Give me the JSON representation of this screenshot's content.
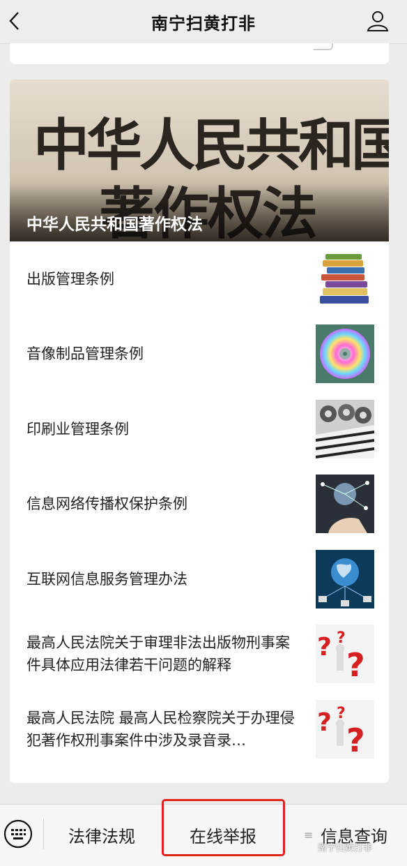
{
  "header": {
    "title": "南宁扫黄打非"
  },
  "hero": {
    "image_text_line1": "中华人民共和国",
    "image_text_line2": "著作权法",
    "caption": "中华人民共和国著作权法"
  },
  "articles": [
    {
      "title": "出版管理条例",
      "thumb": "books-icon"
    },
    {
      "title": "音像制品管理条例",
      "thumb": "cd-disc-icon"
    },
    {
      "title": "印刷业管理条例",
      "thumb": "printing-press-icon"
    },
    {
      "title": "信息网络传播权保护条例",
      "thumb": "network-hand-icon"
    },
    {
      "title": "互联网信息服务管理办法",
      "thumb": "globe-network-icon"
    },
    {
      "title": "最高人民法院关于审理非法出版物刑事案件具体应用法律若干问题的解释",
      "thumb": "question-marks-icon"
    },
    {
      "title": "最高人民法院 最高人民检察院关于办理侵犯著作权刑事案件中涉及录音录…",
      "thumb": "question-marks-icon"
    }
  ],
  "bottom_menu": {
    "tab1": "法律法规",
    "tab2": "在线举报",
    "tab3": "信息查询",
    "menu_glyph": "≡"
  },
  "watermark": "南宁扫黄打非",
  "colors": {
    "highlight": "#e0221d"
  }
}
